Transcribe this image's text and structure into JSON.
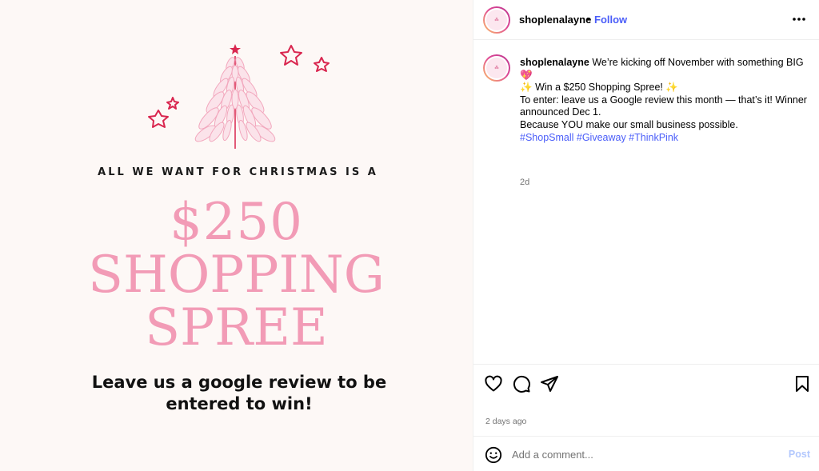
{
  "post_image": {
    "headline_small": "ALL WE WANT FOR CHRISTMAS IS A",
    "amount": "$250",
    "line_shopping": "SHOPPING",
    "line_spree": "SPREE",
    "cta_line1": "Leave us a google review to be",
    "cta_line2": "entered to win!",
    "accent_color": "#f29bb6",
    "star_color": "#d9264f"
  },
  "header": {
    "username": "shoplenalayne",
    "separator": "•",
    "follow_label": "Follow"
  },
  "caption": {
    "username": "shoplenalayne",
    "line1": "We’re kicking off November with something BIG",
    "heart_emoji": "💖",
    "sparkle_emoji": "✨",
    "line2": "Win a $250 Shopping Spree!",
    "line3": "To enter: leave us a Google review this month — that’s it! Winner announced Dec 1.",
    "line4": "Because YOU make our small business possible.",
    "hashtags": "#ShopSmall #Giveaway #ThinkPink",
    "time": "2d"
  },
  "actions": {
    "like_icon": "heart-icon",
    "comment_icon": "comment-bubble-icon",
    "share_icon": "paper-plane-icon",
    "save_icon": "bookmark-icon"
  },
  "post_date": "2 days ago",
  "comment_bar": {
    "placeholder": "Add a comment...",
    "post_label": "Post"
  },
  "colors": {
    "link_blue": "#4a5df9",
    "muted": "#737373",
    "post_disabled": "#b3c8fd"
  }
}
